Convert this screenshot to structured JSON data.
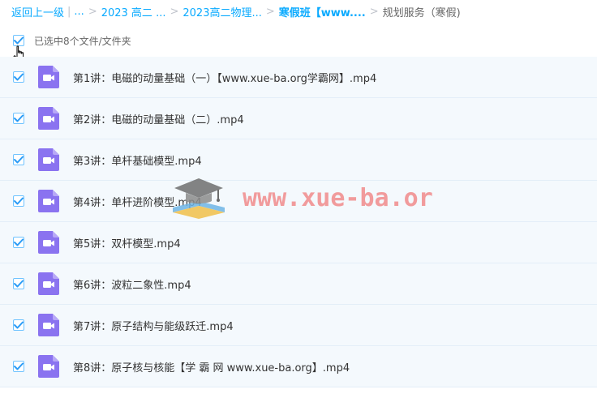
{
  "breadcrumb": {
    "back": "返回上一级",
    "sep": "|",
    "ellipsis": "...",
    "items": [
      "2023 高二 ...",
      "2023高二物理...",
      "寒假班【www...."
    ],
    "current": "规划服务（寒假)"
  },
  "selection": {
    "label": "已选中8个文件/文件夹"
  },
  "files": [
    {
      "name": "第1讲：电磁的动量基础（一）【www.xue-ba.org学霸网】.mp4"
    },
    {
      "name": "第2讲：电磁的动量基础（二）.mp4"
    },
    {
      "name": "第3讲：单杆基础模型.mp4"
    },
    {
      "name": "第4讲：单杆进阶模型.mp4"
    },
    {
      "name": "第5讲：双杆模型.mp4"
    },
    {
      "name": "第6讲：波粒二象性.mp4"
    },
    {
      "name": "第7讲：原子结构与能级跃迁.mp4"
    },
    {
      "name": "第8讲：原子核与核能【学 霸 网 www.xue-ba.org】.mp4"
    }
  ],
  "watermark": {
    "text": "www.xue-ba.org"
  },
  "colors": {
    "link": "#09aaff",
    "check": "#2b9cf6",
    "video_icon": "#8a73f0",
    "row_bg": "#f4f9fd"
  }
}
